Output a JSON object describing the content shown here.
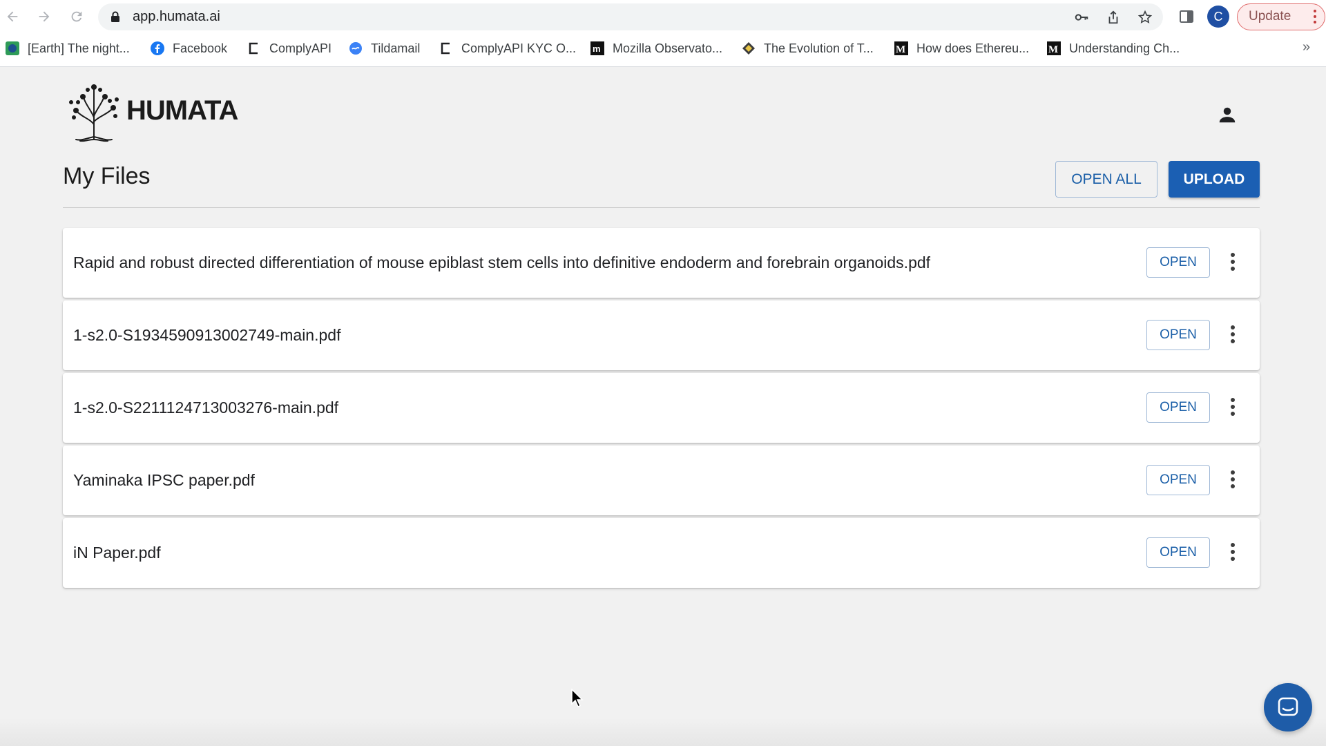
{
  "browser": {
    "url": "app.humata.ai",
    "profile_initial": "C",
    "update_label": "Update",
    "bookmarks": [
      {
        "label": "[Earth] The night...",
        "icon": "earth-favicon"
      },
      {
        "label": "Facebook",
        "icon": "facebook-favicon"
      },
      {
        "label": "ComplyAPI",
        "icon": "complyapi-favicon"
      },
      {
        "label": "Tildamail",
        "icon": "tildamail-favicon"
      },
      {
        "label": "ComplyAPI KYC O...",
        "icon": "complyapi-favicon"
      },
      {
        "label": "Mozilla Observato...",
        "icon": "mozilla-favicon"
      },
      {
        "label": "The Evolution of T...",
        "icon": "diamond-favicon"
      },
      {
        "label": "How does Ethereu...",
        "icon": "medium-favicon"
      },
      {
        "label": "Understanding Ch...",
        "icon": "medium-favicon"
      }
    ],
    "more_bookmarks": "»"
  },
  "app": {
    "logo_text": "HUMATA",
    "page_title": "My Files",
    "open_all_label": "OPEN ALL",
    "upload_label": "UPLOAD",
    "open_label": "OPEN",
    "files": [
      {
        "name": "Rapid and robust directed differentiation of mouse epiblast stem cells into definitive endoderm and forebrain organoids.pdf"
      },
      {
        "name": "1-s2.0-S1934590913002749-main.pdf"
      },
      {
        "name": "1-s2.0-S2211124713003276-main.pdf"
      },
      {
        "name": "Yaminaka IPSC paper.pdf"
      },
      {
        "name": "iN Paper.pdf"
      }
    ]
  },
  "colors": {
    "primary": "#1b5fb3",
    "page_bg": "#f1f1f1",
    "update_border": "#e06b6b"
  }
}
